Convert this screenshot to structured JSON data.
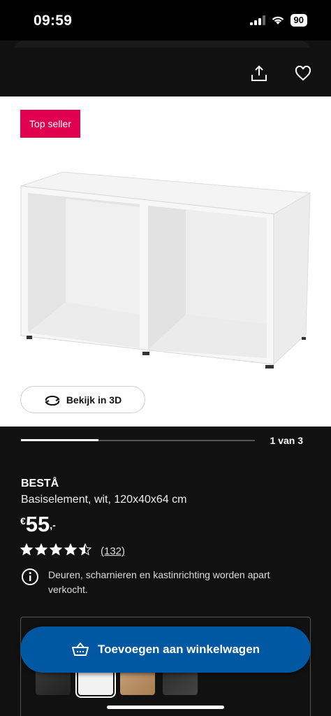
{
  "status": {
    "time": "09:59",
    "battery": "90"
  },
  "badge": "Top seller",
  "view3d_label": "Bekijk in 3D",
  "gallery": {
    "counter": "1 van 3",
    "progress": 0.33
  },
  "product": {
    "name": "BESTÅ",
    "description": "Basiselement, wit, 120x40x64 cm",
    "price_currency": "€",
    "price_amount": "55",
    "price_suffix": ",-",
    "rating": 4.5,
    "reviews": "(132)"
  },
  "notice": "Deuren, scharnieren en kastinrichting worden apart verkocht.",
  "cart_label": "Toevoegen aan winkelwagen",
  "icons": [
    "share-icon",
    "heart-icon",
    "rotate-3d-icon",
    "star-icon",
    "info-icon",
    "cart-icon"
  ],
  "colors": {
    "badge": "#e0004d",
    "cta": "#0058a3",
    "background": "#111111"
  },
  "variants": [
    "black-brown",
    "white",
    "oak",
    "dark"
  ]
}
